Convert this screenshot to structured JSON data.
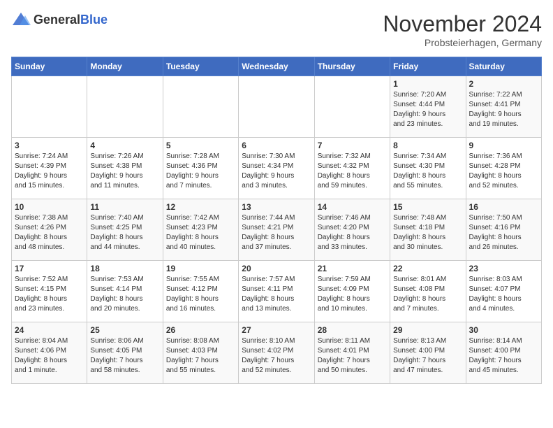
{
  "header": {
    "logo_general": "General",
    "logo_blue": "Blue",
    "month_title": "November 2024",
    "subtitle": "Probsteierhagen, Germany"
  },
  "weekdays": [
    "Sunday",
    "Monday",
    "Tuesday",
    "Wednesday",
    "Thursday",
    "Friday",
    "Saturday"
  ],
  "weeks": [
    [
      {
        "day": "",
        "info": ""
      },
      {
        "day": "",
        "info": ""
      },
      {
        "day": "",
        "info": ""
      },
      {
        "day": "",
        "info": ""
      },
      {
        "day": "",
        "info": ""
      },
      {
        "day": "1",
        "info": "Sunrise: 7:20 AM\nSunset: 4:44 PM\nDaylight: 9 hours\nand 23 minutes."
      },
      {
        "day": "2",
        "info": "Sunrise: 7:22 AM\nSunset: 4:41 PM\nDaylight: 9 hours\nand 19 minutes."
      }
    ],
    [
      {
        "day": "3",
        "info": "Sunrise: 7:24 AM\nSunset: 4:39 PM\nDaylight: 9 hours\nand 15 minutes."
      },
      {
        "day": "4",
        "info": "Sunrise: 7:26 AM\nSunset: 4:38 PM\nDaylight: 9 hours\nand 11 minutes."
      },
      {
        "day": "5",
        "info": "Sunrise: 7:28 AM\nSunset: 4:36 PM\nDaylight: 9 hours\nand 7 minutes."
      },
      {
        "day": "6",
        "info": "Sunrise: 7:30 AM\nSunset: 4:34 PM\nDaylight: 9 hours\nand 3 minutes."
      },
      {
        "day": "7",
        "info": "Sunrise: 7:32 AM\nSunset: 4:32 PM\nDaylight: 8 hours\nand 59 minutes."
      },
      {
        "day": "8",
        "info": "Sunrise: 7:34 AM\nSunset: 4:30 PM\nDaylight: 8 hours\nand 55 minutes."
      },
      {
        "day": "9",
        "info": "Sunrise: 7:36 AM\nSunset: 4:28 PM\nDaylight: 8 hours\nand 52 minutes."
      }
    ],
    [
      {
        "day": "10",
        "info": "Sunrise: 7:38 AM\nSunset: 4:26 PM\nDaylight: 8 hours\nand 48 minutes."
      },
      {
        "day": "11",
        "info": "Sunrise: 7:40 AM\nSunset: 4:25 PM\nDaylight: 8 hours\nand 44 minutes."
      },
      {
        "day": "12",
        "info": "Sunrise: 7:42 AM\nSunset: 4:23 PM\nDaylight: 8 hours\nand 40 minutes."
      },
      {
        "day": "13",
        "info": "Sunrise: 7:44 AM\nSunset: 4:21 PM\nDaylight: 8 hours\nand 37 minutes."
      },
      {
        "day": "14",
        "info": "Sunrise: 7:46 AM\nSunset: 4:20 PM\nDaylight: 8 hours\nand 33 minutes."
      },
      {
        "day": "15",
        "info": "Sunrise: 7:48 AM\nSunset: 4:18 PM\nDaylight: 8 hours\nand 30 minutes."
      },
      {
        "day": "16",
        "info": "Sunrise: 7:50 AM\nSunset: 4:16 PM\nDaylight: 8 hours\nand 26 minutes."
      }
    ],
    [
      {
        "day": "17",
        "info": "Sunrise: 7:52 AM\nSunset: 4:15 PM\nDaylight: 8 hours\nand 23 minutes."
      },
      {
        "day": "18",
        "info": "Sunrise: 7:53 AM\nSunset: 4:14 PM\nDaylight: 8 hours\nand 20 minutes."
      },
      {
        "day": "19",
        "info": "Sunrise: 7:55 AM\nSunset: 4:12 PM\nDaylight: 8 hours\nand 16 minutes."
      },
      {
        "day": "20",
        "info": "Sunrise: 7:57 AM\nSunset: 4:11 PM\nDaylight: 8 hours\nand 13 minutes."
      },
      {
        "day": "21",
        "info": "Sunrise: 7:59 AM\nSunset: 4:09 PM\nDaylight: 8 hours\nand 10 minutes."
      },
      {
        "day": "22",
        "info": "Sunrise: 8:01 AM\nSunset: 4:08 PM\nDaylight: 8 hours\nand 7 minutes."
      },
      {
        "day": "23",
        "info": "Sunrise: 8:03 AM\nSunset: 4:07 PM\nDaylight: 8 hours\nand 4 minutes."
      }
    ],
    [
      {
        "day": "24",
        "info": "Sunrise: 8:04 AM\nSunset: 4:06 PM\nDaylight: 8 hours\nand 1 minute."
      },
      {
        "day": "25",
        "info": "Sunrise: 8:06 AM\nSunset: 4:05 PM\nDaylight: 7 hours\nand 58 minutes."
      },
      {
        "day": "26",
        "info": "Sunrise: 8:08 AM\nSunset: 4:03 PM\nDaylight: 7 hours\nand 55 minutes."
      },
      {
        "day": "27",
        "info": "Sunrise: 8:10 AM\nSunset: 4:02 PM\nDaylight: 7 hours\nand 52 minutes."
      },
      {
        "day": "28",
        "info": "Sunrise: 8:11 AM\nSunset: 4:01 PM\nDaylight: 7 hours\nand 50 minutes."
      },
      {
        "day": "29",
        "info": "Sunrise: 8:13 AM\nSunset: 4:00 PM\nDaylight: 7 hours\nand 47 minutes."
      },
      {
        "day": "30",
        "info": "Sunrise: 8:14 AM\nSunset: 4:00 PM\nDaylight: 7 hours\nand 45 minutes."
      }
    ]
  ]
}
